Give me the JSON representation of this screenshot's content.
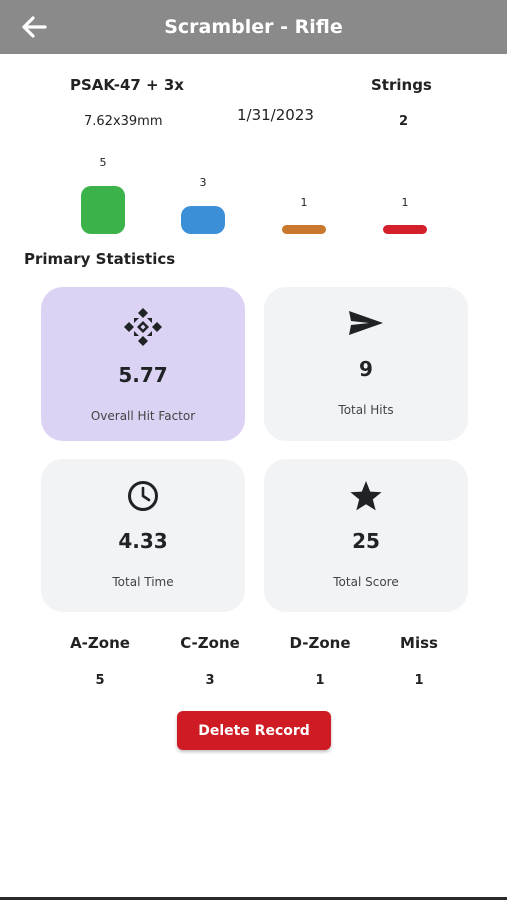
{
  "app_bar": {
    "title": "Scrambler - Rifle",
    "back_icon": "arrow-left-icon",
    "background": "#8a8a8a"
  },
  "summary": {
    "firearm": "PSAK-47 + 3x",
    "caliber": "7.62x39mm",
    "date": "1/31/2023",
    "strings_label": "Strings",
    "strings_value": "2"
  },
  "zone_bars": [
    {
      "zone": "A",
      "count": "5",
      "color": "#3bb34a"
    },
    {
      "zone": "C",
      "count": "3",
      "color": "#3a8fd6"
    },
    {
      "zone": "D",
      "count": "1",
      "color": "#c9772c"
    },
    {
      "zone": "Miss",
      "count": "1",
      "color": "#d4202a"
    }
  ],
  "primary_statistics": {
    "title": "Primary Statistics",
    "cards": [
      {
        "icon": "hit-factor-icon",
        "value": "5.77",
        "label": "Overall Hit Factor",
        "highlight": true
      },
      {
        "icon": "send-icon",
        "value": "9",
        "label": "Total Hits",
        "highlight": false
      },
      {
        "icon": "clock-icon",
        "value": "4.33",
        "label": "Total Time",
        "highlight": false
      },
      {
        "icon": "star-icon",
        "value": "25",
        "label": "Total Score",
        "highlight": false
      }
    ]
  },
  "zones_table": {
    "headers": [
      "A-Zone",
      "C-Zone",
      "D-Zone",
      "Miss"
    ],
    "values": [
      "5",
      "3",
      "1",
      "1"
    ]
  },
  "actions": {
    "delete_label": "Delete Record",
    "delete_color": "#cf1c24"
  },
  "colors": {
    "highlight_card": "#dcd3f4",
    "card": "#f1f3f5"
  }
}
